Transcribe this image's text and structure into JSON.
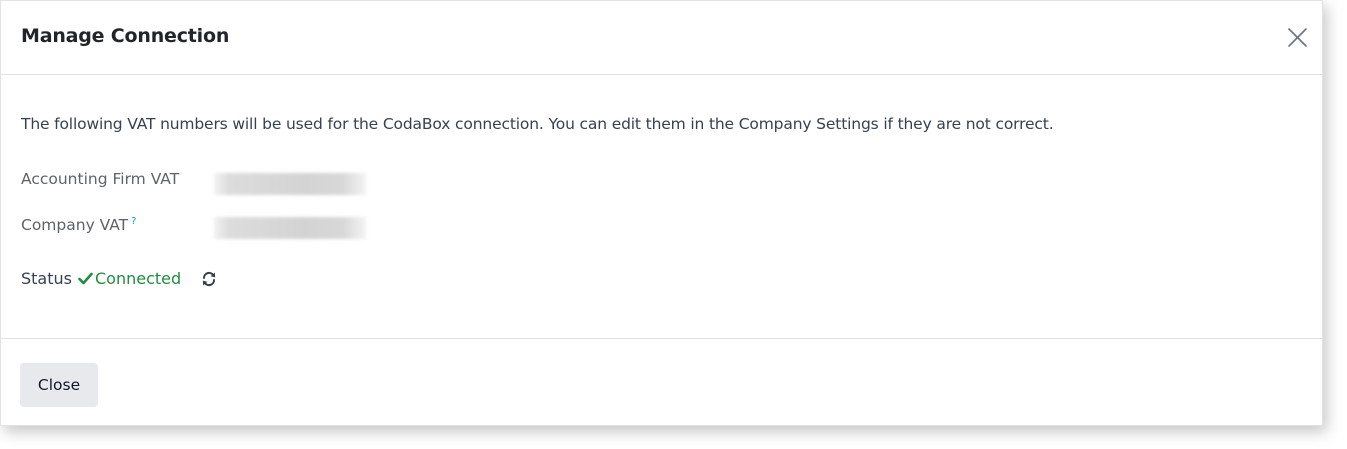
{
  "dialog": {
    "title": "Manage Connection",
    "close_icon": "close-x-icon"
  },
  "body": {
    "intro": "The following VAT numbers will be used for the CodaBox connection. You can edit them in the Company Settings if they are not correct.",
    "fields": [
      {
        "label": "Accounting Firm VAT",
        "value_state": "redacted"
      },
      {
        "label": "Company VAT",
        "help_marker": "?",
        "value_state": "redacted"
      }
    ],
    "status": {
      "label": "Status",
      "value": "Connected",
      "icon": "check-icon",
      "refresh_icon": "refresh-icon"
    }
  },
  "footer": {
    "close_label": "Close"
  },
  "colors": {
    "success": "#1e8e3e",
    "help": "#1a9fc7",
    "button_bg": "#e7e9ed"
  }
}
